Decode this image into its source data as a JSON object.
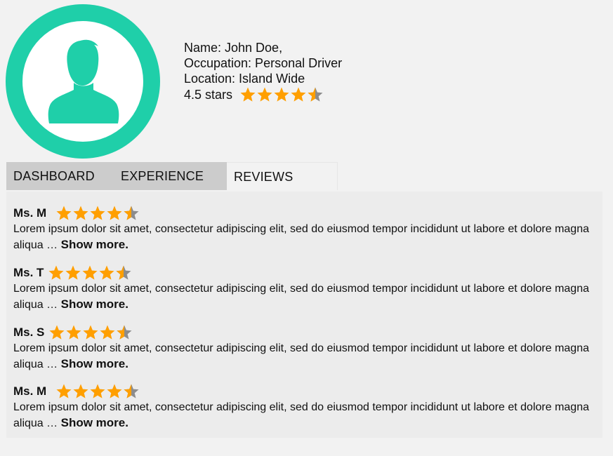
{
  "colors": {
    "accent": "#1fcfa9",
    "star": "#ff9f00",
    "star_empty": "#8c8c8c",
    "tab_inactive": "#cccccc"
  },
  "profile": {
    "name": "Name: John Doe,",
    "occupation": "Occupation: Personal Driver",
    "location": "Location: Island Wide",
    "rating_text": "4.5 stars",
    "rating": 4.5,
    "avatar_icon": "user-silhouette-icon"
  },
  "tabs": [
    {
      "label": "DASHBOARD",
      "active": false
    },
    {
      "label": "EXPERIENCE",
      "active": false
    },
    {
      "label": "REVIEWS",
      "active": true
    }
  ],
  "reviews": [
    {
      "name": "Ms. M",
      "rating": 4.5,
      "text": "Lorem ipsum dolor sit amet, consectetur adipiscing elit, sed do eiusmod tempor incididunt ut labore et dolore magna aliqua …",
      "more": "Show more."
    },
    {
      "name": "Ms. T",
      "rating": 4.5,
      "text": "Lorem ipsum dolor sit amet, consectetur adipiscing elit, sed do eiusmod tempor incididunt ut labore et dolore magna aliqua …",
      "more": "Show more."
    },
    {
      "name": "Ms. S",
      "rating": 4.5,
      "text": "Lorem ipsum dolor sit amet, consectetur adipiscing elit, sed do eiusmod tempor incididunt ut labore et dolore magna aliqua …",
      "more": "Show more."
    },
    {
      "name": "Ms. M",
      "rating": 4.5,
      "text": "Lorem ipsum dolor sit amet, consectetur adipiscing elit, sed do eiusmod tempor incididunt ut labore et dolore magna aliqua …",
      "more": "Show more."
    }
  ]
}
